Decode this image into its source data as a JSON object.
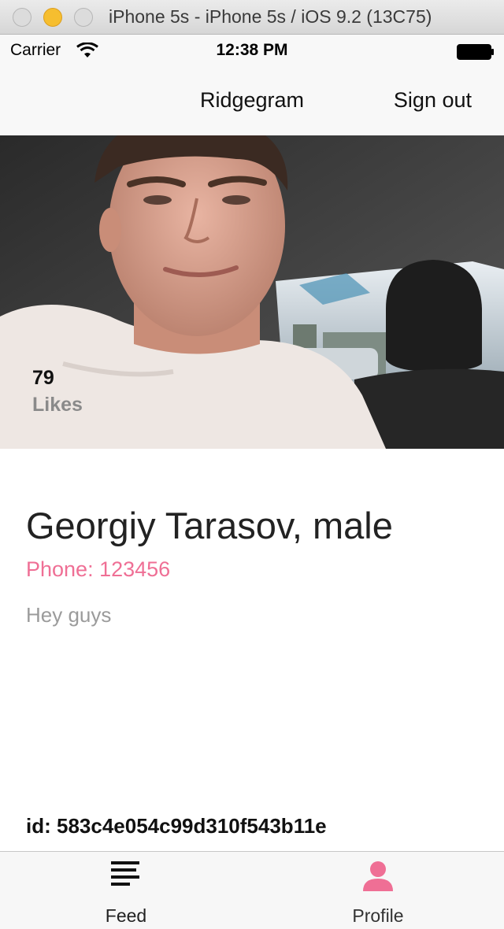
{
  "window": {
    "title": "iPhone 5s - iPhone 5s / iOS 9.2 (13C75)"
  },
  "status_bar": {
    "carrier": "Carrier",
    "time": "12:38 PM",
    "wifi_icon": "wifi-icon",
    "battery_icon": "battery-icon"
  },
  "navbar": {
    "title": "Ridgegram",
    "sign_out_label": "Sign out"
  },
  "profile": {
    "photo": "profile-photo",
    "likes_count": "79",
    "likes_label": "Likes",
    "name": "Georgiy Tarasov, male",
    "phone": "Phone: 123456",
    "bio": "Hey guys",
    "id": "id: 583c4e054c99d310f543b11e"
  },
  "tabbar": {
    "tabs": [
      {
        "label": "Feed",
        "icon": "feed-list-icon",
        "selected": false
      },
      {
        "label": "Profile",
        "icon": "person-icon",
        "selected": true
      }
    ]
  },
  "colors": {
    "accent_pink": "#ef6f95",
    "navbar_bg": "#f8f8f8",
    "tabbar_bg": "#f7f7f7",
    "bio_gray": "#9b9b9b"
  }
}
